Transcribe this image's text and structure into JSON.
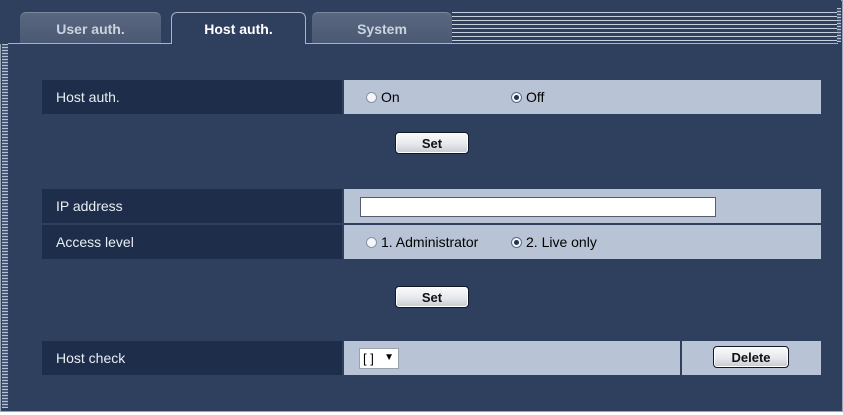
{
  "tabs": [
    {
      "label": "User auth.",
      "active": false
    },
    {
      "label": "Host auth.",
      "active": true
    },
    {
      "label": "System",
      "active": false
    }
  ],
  "host_auth": {
    "label": "Host auth.",
    "options": [
      {
        "label": "On",
        "selected": false
      },
      {
        "label": "Off",
        "selected": true
      }
    ],
    "set_label": "Set"
  },
  "ip_address": {
    "label": "IP address",
    "value": ""
  },
  "access_level": {
    "label": "Access level",
    "options": [
      {
        "label": "1. Administrator",
        "selected": false
      },
      {
        "label": "2. Live only",
        "selected": true
      }
    ],
    "set_label": "Set"
  },
  "host_check": {
    "label": "Host check",
    "selected": "[ ]",
    "delete_label": "Delete"
  },
  "colors": {
    "background": "#2f3f5e",
    "label_cell": "#1e2e4a",
    "value_cell": "#b8c4d6"
  }
}
